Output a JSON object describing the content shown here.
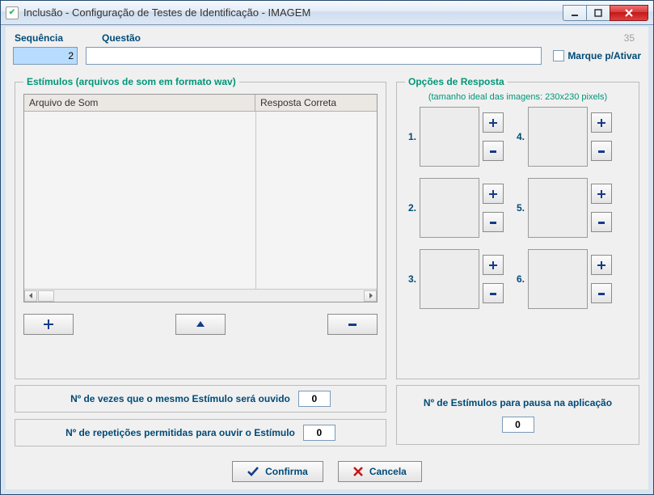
{
  "window": {
    "title": "Inclusão - Configuração de Testes de Identificação - IMAGEM",
    "id": "35"
  },
  "top": {
    "seq_label": "Sequência",
    "seq_value": "2",
    "quest_label": "Questão",
    "quest_value": "",
    "mark_label": "Marque p/Ativar"
  },
  "stimuli": {
    "legend": "Estímulos (arquivos de som em formato wav)",
    "col1": "Arquivo de Som",
    "col2": "Resposta Correta"
  },
  "responses": {
    "legend": "Opções de Resposta",
    "hint": "(tamanho ideal das imagens: 230x230 pixels)",
    "nums": [
      "1.",
      "2.",
      "3.",
      "4.",
      "5.",
      "6."
    ]
  },
  "below": {
    "times_heard_label": "Nº de vezes que o mesmo Estímulo será ouvido",
    "times_heard_value": "0",
    "reps_label": "Nº de repetições permitidas para ouvir o Estímulo",
    "reps_value": "0",
    "pause_label": "Nº de Estímulos para pausa na aplicação",
    "pause_value": "0"
  },
  "actions": {
    "confirm": "Confirma",
    "cancel": "Cancela"
  }
}
